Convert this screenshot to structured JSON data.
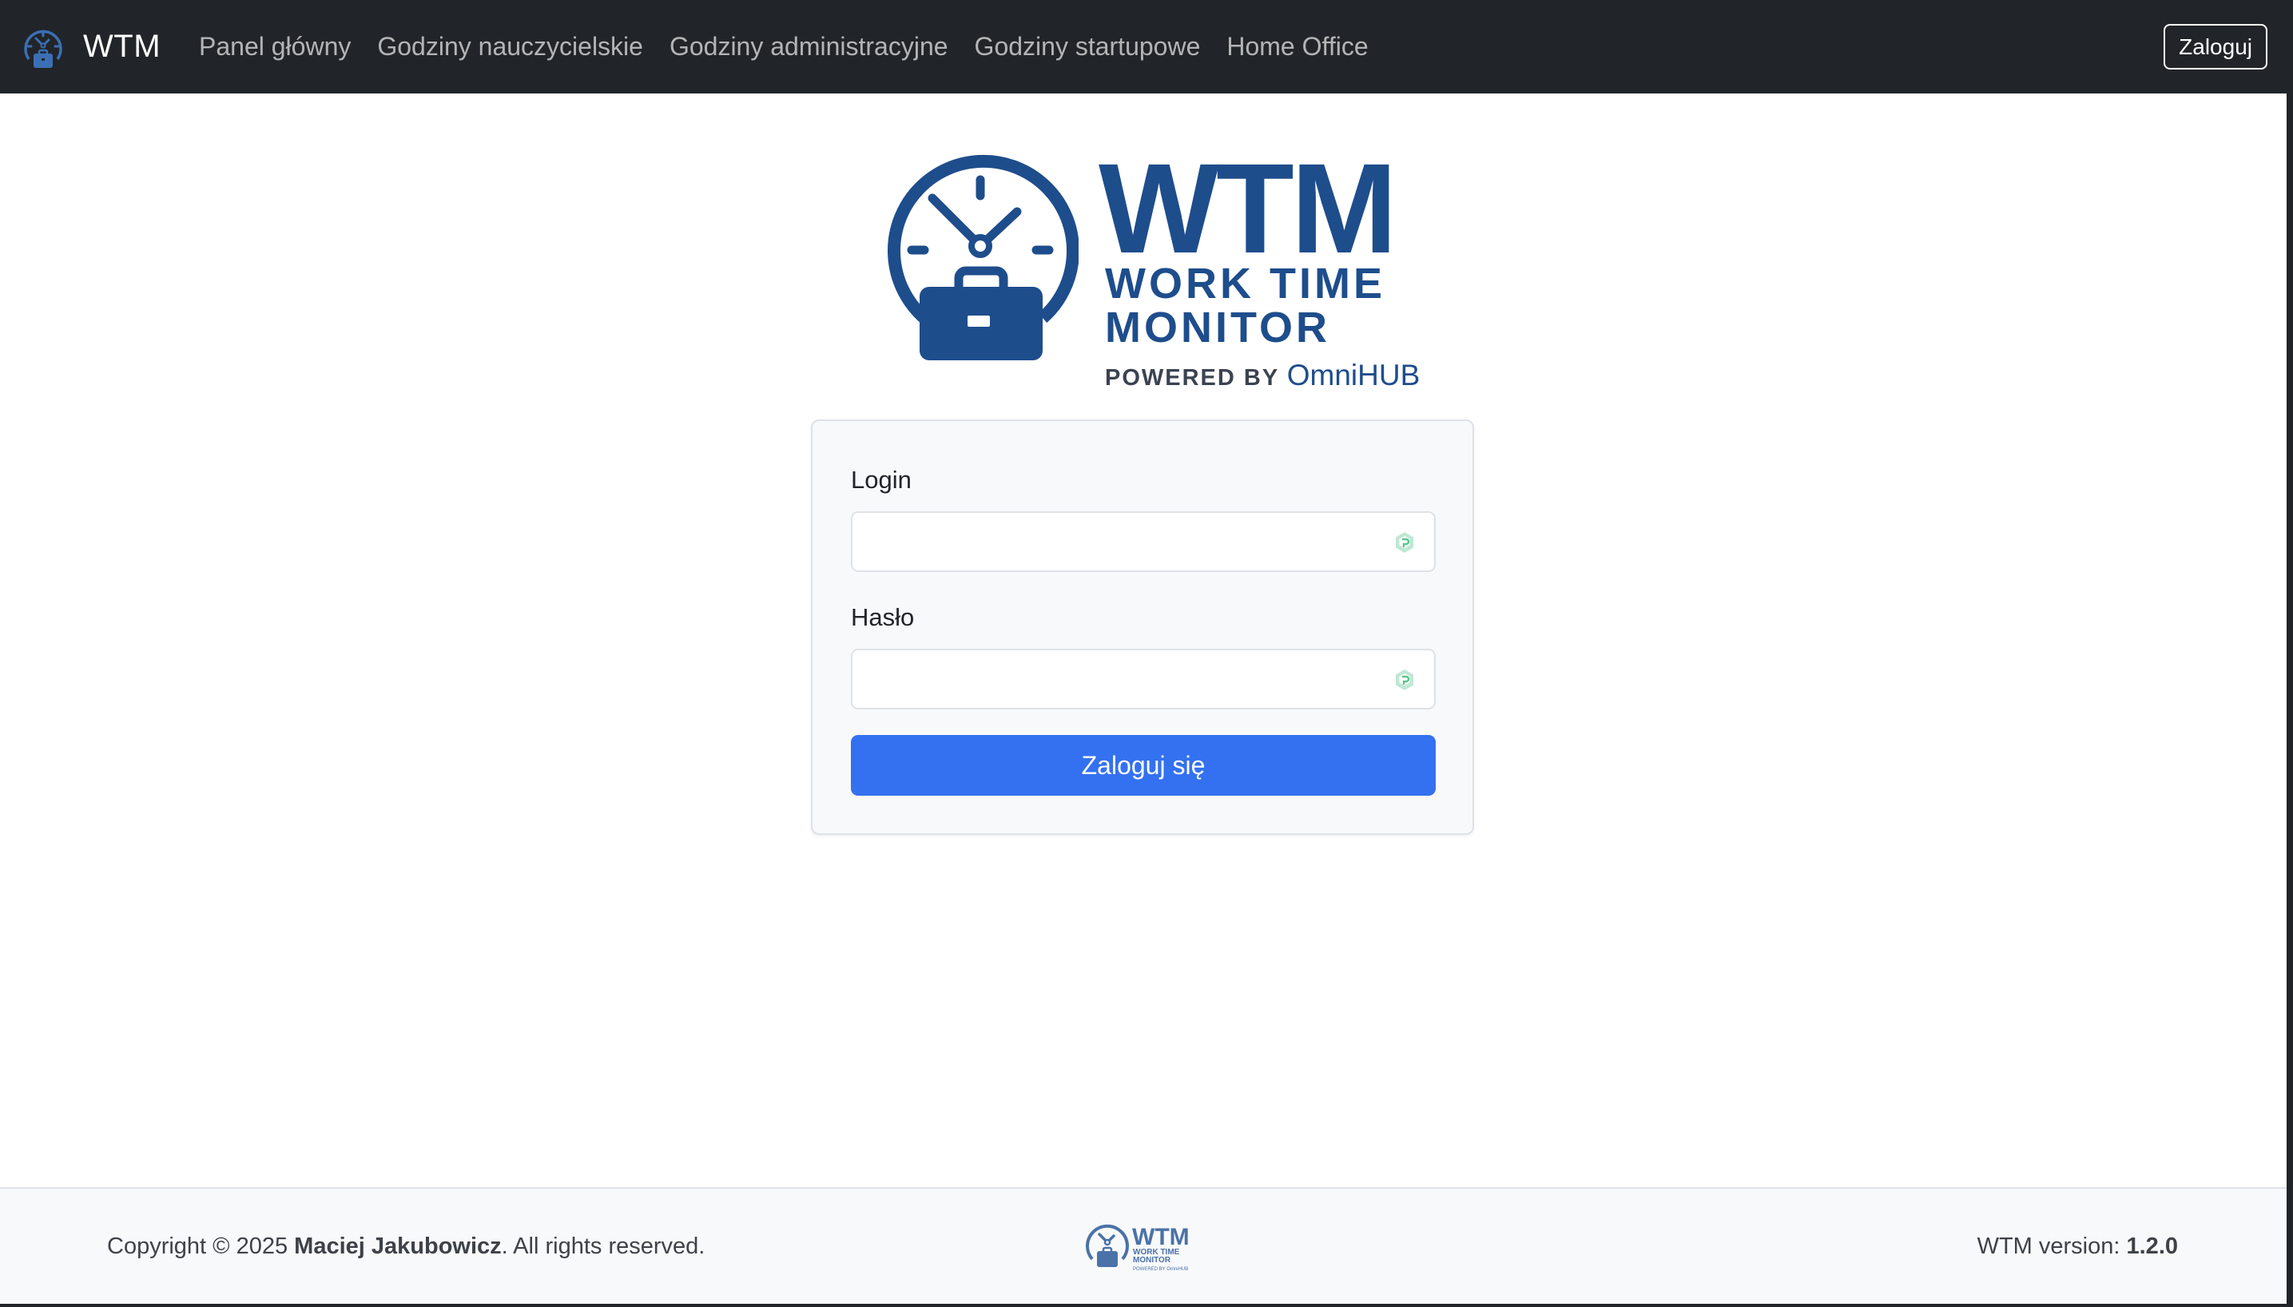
{
  "navbar": {
    "brand": "WTM",
    "links": [
      "Panel główny",
      "Godziny nauczycielskie",
      "Godziny administracyjne",
      "Godziny startupowe",
      "Home Office"
    ],
    "login_button": "Zaloguj"
  },
  "logo": {
    "title": "WTM",
    "line1": "WORK TIME",
    "line2": "MONITOR",
    "powered_by": "POWERED BY",
    "brand": "OmniHUB"
  },
  "form": {
    "login_label": "Login",
    "login_value": "",
    "password_label": "Hasło",
    "password_value": "",
    "submit_label": "Zaloguj się"
  },
  "footer": {
    "copyright_prefix": "Copyright © 2025 ",
    "author": "Maciej Jakubowicz",
    "copyright_suffix": ". All rights reserved.",
    "version_label": "WTM version: ",
    "version": "1.2.0"
  },
  "colors": {
    "navbar": "#212529",
    "brand_blue": "#1e4d8c",
    "primary_button": "#3471f0",
    "card_background": "#f8f9fa"
  },
  "icons": {
    "brand": "wtm-clock-briefcase-icon",
    "input_autofill": "password-manager-icon"
  }
}
